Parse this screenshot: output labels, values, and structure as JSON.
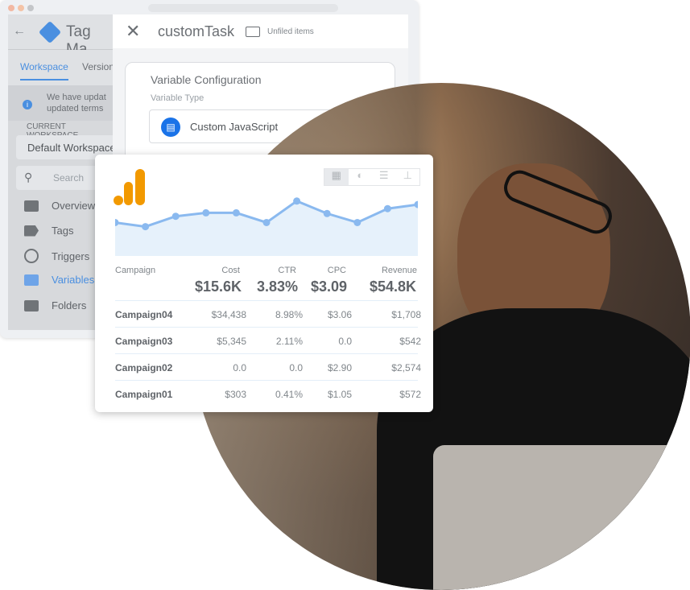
{
  "window": {
    "traffic_colors": [
      "#f2b8a2",
      "#f4c3a6",
      "#c4c6c9"
    ]
  },
  "sidebar": {
    "app_title": "Tag Ma",
    "tabs": [
      {
        "label": "Workspace",
        "active": true
      },
      {
        "label": "Version"
      }
    ],
    "notice": [
      "We have updat",
      "updated terms"
    ],
    "current_workspace_label": "CURRENT WORKSPACE",
    "workspace": "Default Workspace",
    "search_placeholder": "Search",
    "items": [
      {
        "label": "Overview",
        "icon": "overview-icon"
      },
      {
        "label": "Tags",
        "icon": "tag-icon"
      },
      {
        "label": "Triggers",
        "icon": "trigger-icon"
      },
      {
        "label": "Variables",
        "icon": "variables-icon",
        "active": true
      },
      {
        "label": "Folders",
        "icon": "folder-icon"
      }
    ]
  },
  "panel": {
    "title": "customTask",
    "folder": "Unfiled items",
    "config_title": "Variable Configuration",
    "type_label": "Variable Type",
    "type_value": "Custom JavaScript"
  },
  "accent": "#4285f4",
  "analytics": {
    "logo_color": "#f29900",
    "chart_data": {
      "type": "area",
      "values": [
        46,
        40,
        55,
        60,
        60,
        46,
        77,
        59,
        46,
        66,
        72
      ],
      "color": "#8ab9ef",
      "fill": "#e6f1fb",
      "grid": false
    },
    "columns": [
      "Campaign",
      "Cost",
      "CTR",
      "CPC",
      "Revenue"
    ],
    "totals": [
      "$15.6K",
      "3.83%",
      "$3.09",
      "$54.8K"
    ],
    "rows": [
      [
        "Campaign04",
        "$34,438",
        "8.98%",
        "$3.06",
        "$1,708"
      ],
      [
        "Campaign03",
        "$5,345",
        "2.11%",
        "0.0",
        "$542"
      ],
      [
        "Campaign02",
        "0.0",
        "0.0",
        "$2.90",
        "$2,574"
      ],
      [
        "Campaign01",
        "$303",
        "0.41%",
        "$1.05",
        "$572"
      ]
    ],
    "view_buttons": [
      "table-icon",
      "pie-icon",
      "bar-icon",
      "pivot-icon"
    ]
  }
}
